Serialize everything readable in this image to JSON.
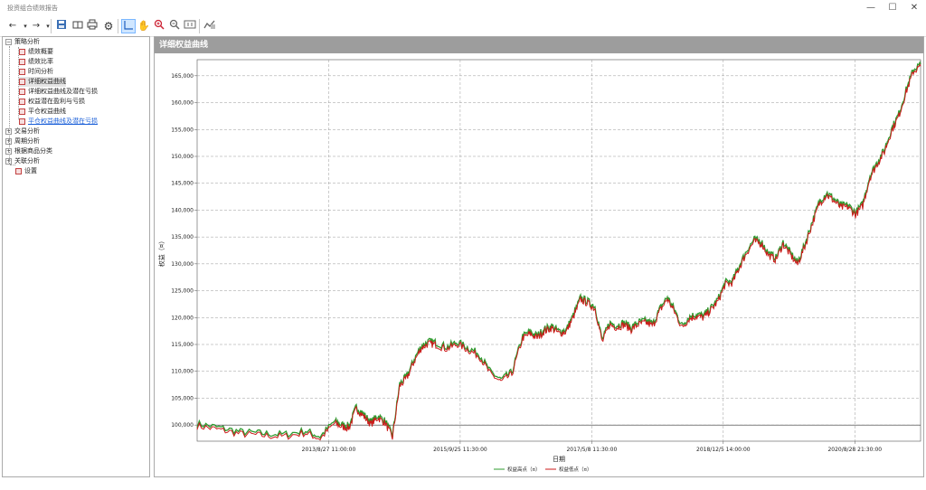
{
  "window": {
    "title": "投资组合绩效报告",
    "minimize": "—",
    "maximize": "☐",
    "close": "✕"
  },
  "toolbar": {
    "icons": [
      "back-icon",
      "dropdown-icon",
      "forward-icon",
      "save-icon",
      "open-icon",
      "print-icon",
      "settings-icon",
      "select-icon",
      "pan-icon",
      "zoom-in-icon",
      "zoom-out-icon",
      "fit-icon",
      "chart-style-icon"
    ]
  },
  "tree": {
    "groups": [
      {
        "label": "策略分析",
        "expanded": true,
        "children": [
          {
            "label": "绩效概要"
          },
          {
            "label": "绩效比率"
          },
          {
            "label": "时间分析"
          },
          {
            "label": "详细权益曲线",
            "selected": true
          },
          {
            "label": "详细权益曲线及潜在亏损"
          },
          {
            "label": "权益潜在盈利与亏损"
          },
          {
            "label": "平仓权益曲线"
          },
          {
            "label": "平仓权益曲线及潜在亏损",
            "link": true
          }
        ]
      },
      {
        "label": "交易分析",
        "expanded": false
      },
      {
        "label": "周期分析",
        "expanded": false
      },
      {
        "label": "根据商品分类",
        "expanded": false
      },
      {
        "label": "关联分析",
        "expanded": false
      }
    ],
    "settings": "设置"
  },
  "panel": {
    "title": "详细权益曲线"
  },
  "chart_data": {
    "type": "line",
    "xlabel": "日期",
    "ylabel": "权益（¤）",
    "x_ticks": [
      "2013/8/27 11:00:00",
      "2015/9/25 11:30:00",
      "2017/5/8 11:30:00",
      "2018/12/5 14:00:00",
      "2020/8/28 21:30:00"
    ],
    "ylim": [
      97000,
      168000
    ],
    "y_ticks": [
      "100,000",
      "105,000",
      "110,000",
      "115,000",
      "120,000",
      "125,000",
      "130,000",
      "135,000",
      "140,000",
      "145,000",
      "150,000",
      "155,000",
      "160,000",
      "165,000"
    ],
    "grid": true,
    "reference_line": 100000,
    "series": [
      {
        "name": "权益高点（¤）",
        "color": "#2e9b2e"
      },
      {
        "name": "权益低点（¤）",
        "color": "#cc1a1a"
      }
    ],
    "x": [
      0,
      0.03,
      0.06,
      0.09,
      0.12,
      0.15,
      0.17,
      0.19,
      0.2,
      0.21,
      0.22,
      0.23,
      0.24,
      0.25,
      0.26,
      0.27,
      0.28,
      0.29,
      0.3,
      0.31,
      0.32,
      0.33,
      0.345,
      0.36,
      0.375,
      0.39,
      0.405,
      0.42,
      0.435,
      0.45,
      0.46,
      0.47,
      0.48,
      0.49,
      0.5,
      0.51,
      0.52,
      0.53,
      0.54,
      0.55,
      0.56,
      0.57,
      0.58,
      0.59,
      0.6,
      0.61,
      0.62,
      0.63,
      0.64,
      0.65,
      0.66,
      0.67,
      0.68,
      0.69,
      0.7,
      0.71,
      0.72,
      0.73,
      0.74,
      0.75,
      0.76,
      0.77,
      0.78,
      0.79,
      0.8,
      0.81,
      0.82,
      0.83,
      0.84,
      0.85,
      0.86,
      0.87,
      0.88,
      0.89,
      0.9,
      0.91,
      0.92,
      0.93,
      0.94,
      0.95,
      0.96,
      0.97,
      0.98,
      0.99,
      1.0
    ],
    "values": [
      100000,
      99300,
      98500,
      98200,
      98000,
      98700,
      97600,
      100500,
      99800,
      99600,
      103200,
      101800,
      100300,
      101500,
      100500,
      97800,
      107400,
      108900,
      112000,
      114500,
      115300,
      115100,
      114300,
      115200,
      114100,
      113000,
      109700,
      108200,
      109600,
      116300,
      117100,
      116400,
      117600,
      118200,
      117200,
      117500,
      120200,
      123500,
      122800,
      121800,
      115600,
      118800,
      118300,
      118800,
      117900,
      118900,
      119200,
      118600,
      121500,
      123600,
      121200,
      118300,
      119900,
      120400,
      120100,
      121500,
      123200,
      126300,
      126600,
      129600,
      132300,
      134300,
      133900,
      131700,
      130900,
      133800,
      131800,
      130000,
      133400,
      137500,
      141300,
      143000,
      141900,
      140600,
      140700,
      139300,
      140900,
      146200,
      148700,
      151000,
      154900,
      157700,
      162100,
      165900,
      166900
    ]
  },
  "colors": {
    "panel_header": "#9d9d9d",
    "tree_link": "#1a5fd8",
    "toolbar_active": "#cfe6ff"
  }
}
